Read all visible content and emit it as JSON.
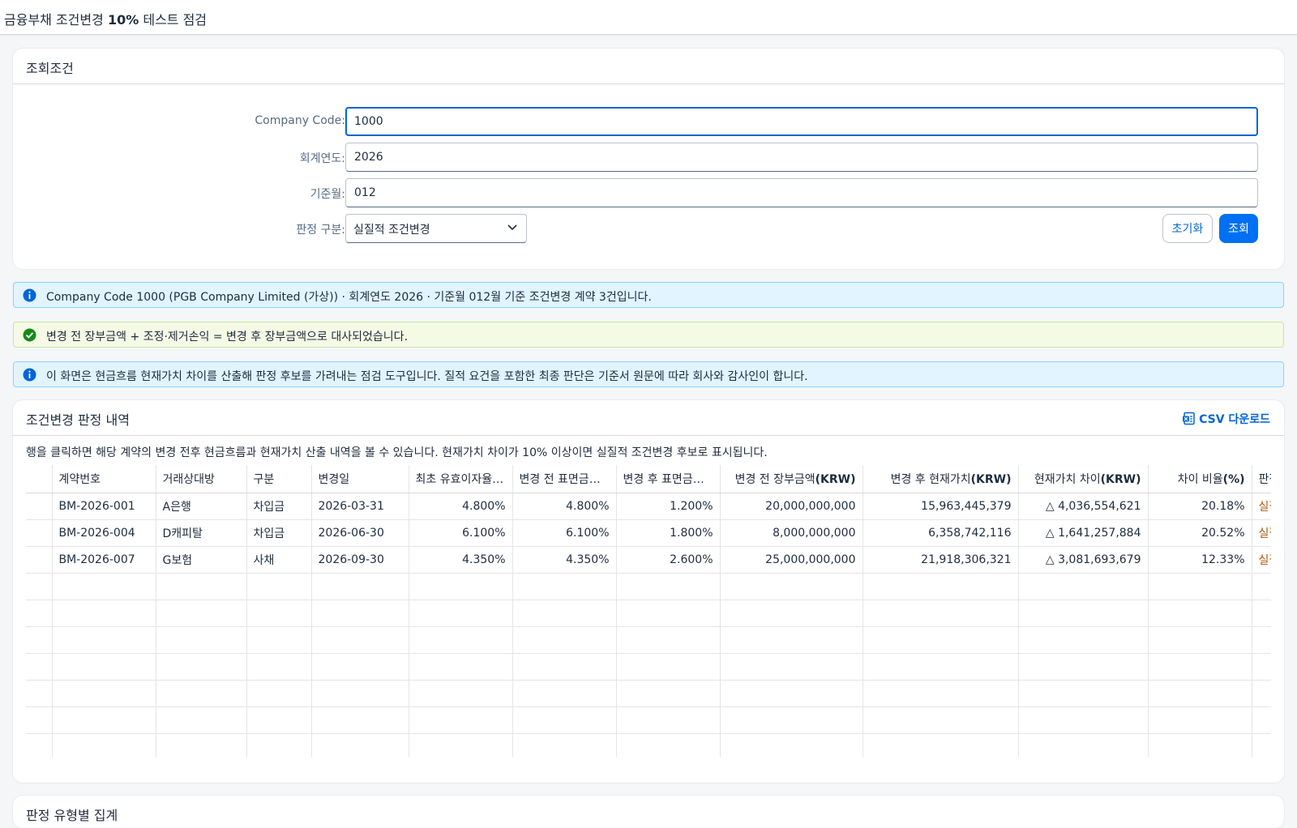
{
  "app": {
    "title_prefix": "금융부채 조건변경",
    "title_bold": "10%",
    "title_suffix": "테스트 점검"
  },
  "filter": {
    "section_title": "조회조건",
    "company_code_label": "Company Code:",
    "company_code_value": "1000",
    "fiscal_year_label": "회계연도:",
    "fiscal_year_value": "2026",
    "period_label": "기준월:",
    "period_value": "012",
    "judgment_label": "판정 구분:",
    "judgment_value": "실질적 조건변경",
    "reset_label": "초기화",
    "search_label": "조회"
  },
  "messages": {
    "info1": "Company Code 1000 (PGB Company Limited (가상)) · 회계연도 2026 · 기준월 012월 기준 조건변경 계약 3건입니다.",
    "success": "변경 전 장부금액 + 조정·제거손익 = 변경 후 장부금액으로 대사되었습니다.",
    "info2": "이 화면은 현금흐름 현재가치 차이를 산출해 판정 후보를 가려내는 점검 도구입니다. 질적 요건을 포함한 최종 판단은 기준서 원문에 따라 회사와 감사인이 합니다."
  },
  "results": {
    "section_title": "조건변경 판정 내역",
    "csv_label": "CSV 다운로드",
    "description": "행을 클릭하면 해당 계약의 변경 전후 현금흐름과 현재가치 산출 내역을 볼 수 있습니다. 현재가치 차이가 10% 이상이면 실질적 조건변경 후보로 표시됩니다.",
    "columns": {
      "contract": "계약번호",
      "counterparty": "거래상대방",
      "type": "구분",
      "change_date": "변경일",
      "orig_eir": "최초 유효이자율(%)",
      "before_rate": "변경 전 표면금리(%)",
      "after_rate": "변경 후 표면금리(%)",
      "carrying_prefix": "변경 전 장부금액",
      "carrying_unit": "(KRW)",
      "pv_after_prefix": "변경 후 현재가치",
      "pv_after_unit": "(KRW)",
      "pv_diff_prefix": "현재가치 차이",
      "pv_diff_unit": "(KRW)",
      "ratio_prefix": "차이 비율",
      "ratio_unit": "(%)",
      "judgment": "판정"
    },
    "rows": [
      {
        "contract": "BM-2026-001",
        "counterparty": "A은행",
        "type": "차입금",
        "change_date": "2026-03-31",
        "orig_eir": "4.800%",
        "before_rate": "4.800%",
        "after_rate": "1.200%",
        "carrying": "20,000,000,000",
        "pv_after": "15,963,445,379",
        "pv_diff": "△ 4,036,554,621",
        "ratio": "20.18%",
        "judgment": "실질적 조건변경"
      },
      {
        "contract": "BM-2026-004",
        "counterparty": "D캐피탈",
        "type": "차입금",
        "change_date": "2026-06-30",
        "orig_eir": "6.100%",
        "before_rate": "6.100%",
        "after_rate": "1.800%",
        "carrying": "8,000,000,000",
        "pv_after": "6,358,742,116",
        "pv_diff": "△ 1,641,257,884",
        "ratio": "20.52%",
        "judgment": "실질적 조건변경"
      },
      {
        "contract": "BM-2026-007",
        "counterparty": "G보험",
        "type": "사채",
        "change_date": "2026-09-30",
        "orig_eir": "4.350%",
        "before_rate": "4.350%",
        "after_rate": "2.600%",
        "carrying": "25,000,000,000",
        "pv_after": "21,918,306,321",
        "pv_diff": "△ 3,081,693,679",
        "ratio": "12.33%",
        "judgment": "실질적 조건변경"
      }
    ]
  },
  "bottom": {
    "section_title": "판정 유형별 집계"
  },
  "colors": {
    "accent": "#0070f2",
    "link": "#0064d9",
    "info_bg": "#e1f4ff",
    "success_bg": "#f5fae5",
    "warning_text": "#aa5808"
  },
  "icons": {
    "info": "info-icon",
    "success": "check-circle-icon",
    "csv": "excel-icon",
    "select": "chevron-down-icon"
  }
}
